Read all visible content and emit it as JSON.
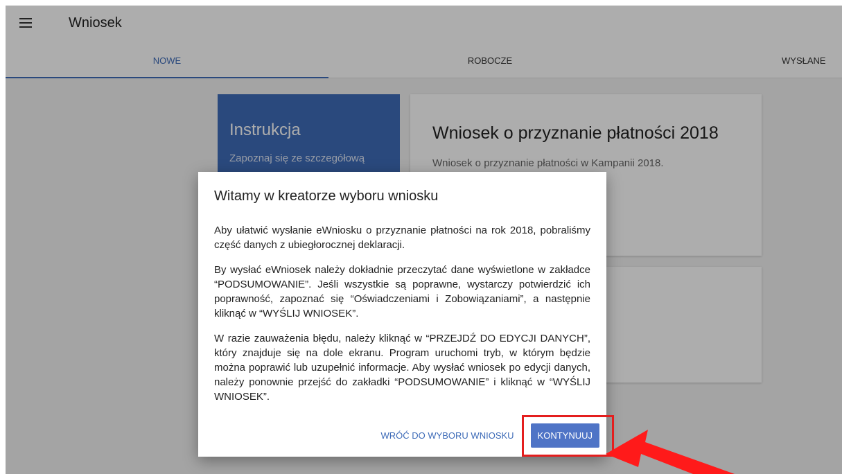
{
  "app": {
    "title": "Wniosek"
  },
  "tabs": [
    {
      "label": "NOWE",
      "active": true
    },
    {
      "label": "ROBOCZE",
      "active": false
    },
    {
      "label": "WYSŁANE",
      "active": false
    }
  ],
  "cards": {
    "instruction": {
      "title": "Instrukcja",
      "text": "Zapoznaj się ze szczegółową"
    },
    "application": {
      "title": "Wniosek o przyznanie płatności 2018",
      "description": "Wniosek o przyznanie płatności w Kampanii 2018."
    }
  },
  "dialog": {
    "title": "Witamy w kreatorze wyboru wniosku",
    "paragraphs": [
      "Aby ułatwić wysłanie eWniosku o przyznanie płatności na rok 2018, pobraliśmy część danych z ubiegłorocznej deklaracji.",
      "By wysłać eWniosek należy dokładnie przeczytać dane wyświetlone w zakładce “PODSUMOWANIE”. Jeśli wszystkie są poprawne, wystarczy potwierdzić ich poprawność, zapoznać się “Oświadczeniami i Zobowiązaniami”, a następnie kliknąć w “WYŚLIJ WNIOSEK”.",
      "W razie zauważenia błędu, należy kliknąć w “PRZEJDŹ DO EDYCJI DANYCH”, który znajduje się na dole ekranu. Program uruchomi tryb, w którym będzie można poprawić lub uzupełnić informacje. Aby wysłać wniosek po edycji danych, należy ponownie przejść do zakładki “PODSUMOWANIE” i kliknąć w “WYŚLIJ WNIOSEK”."
    ],
    "back_label": "WRÓĆ DO WYBORU WNIOSKU",
    "continue_label": "KONTYNUUJ"
  },
  "colors": {
    "accent": "#3f6cb8",
    "button": "#4f74c6",
    "annotation": "#e41e1e"
  }
}
